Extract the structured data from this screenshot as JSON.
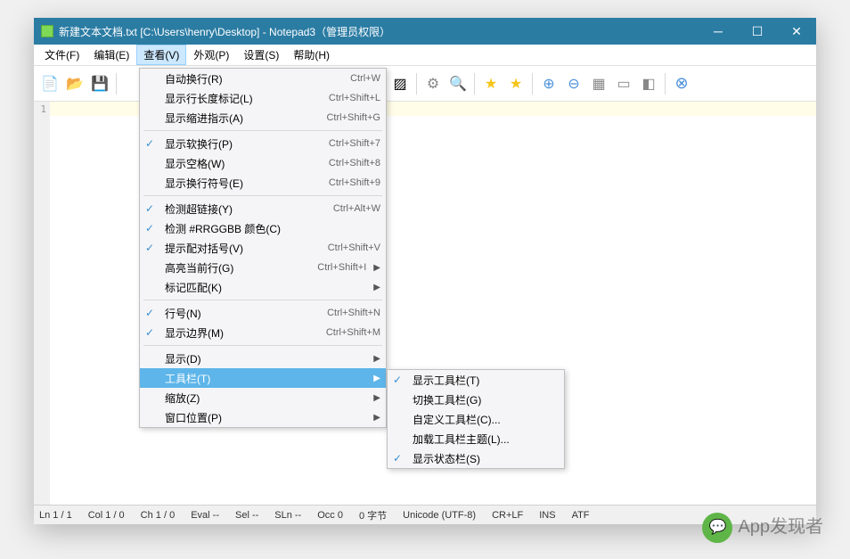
{
  "title": "新建文本文档.txt [C:\\Users\\henry\\Desktop] - Notepad3（管理员权限）",
  "menubar": {
    "file": "文件(F)",
    "edit": "编辑(E)",
    "view": "查看(V)",
    "appearance": "外观(P)",
    "settings": "设置(S)",
    "help": "帮助(H)"
  },
  "gutter_line": "1",
  "view_menu": {
    "word_wrap": "自动换行(R)",
    "word_wrap_acc": "Ctrl+W",
    "long_line_marker": "显示行长度标记(L)",
    "long_line_marker_acc": "Ctrl+Shift+L",
    "indent_guides": "显示缩进指示(A)",
    "indent_guides_acc": "Ctrl+Shift+G",
    "soft_wrap": "显示软换行(P)",
    "soft_wrap_acc": "Ctrl+Shift+7",
    "whitespace": "显示空格(W)",
    "whitespace_acc": "Ctrl+Shift+8",
    "eol": "显示换行符号(E)",
    "eol_acc": "Ctrl+Shift+9",
    "hyperlinks": "检测超链接(Y)",
    "hyperlinks_acc": "Ctrl+Alt+W",
    "rrggbb": "检测 #RRGGBB 颜色(C)",
    "brace_match": "提示配对括号(V)",
    "brace_match_acc": "Ctrl+Shift+V",
    "highlight_line": "高亮当前行(G)",
    "highlight_line_acc": "Ctrl+Shift+I",
    "bookmarks": "标记匹配(K)",
    "line_numbers": "行号(N)",
    "line_numbers_acc": "Ctrl+Shift+N",
    "margin": "显示边界(M)",
    "margin_acc": "Ctrl+Shift+M",
    "display": "显示(D)",
    "toolbars": "工具栏(T)",
    "zoom": "缩放(Z)",
    "window_pos": "窗口位置(P)"
  },
  "toolbars_menu": {
    "show_toolbar": "显示工具栏(T)",
    "switch_toolbar": "切换工具栏(G)",
    "customize_toolbar": "自定义工具栏(C)...",
    "load_theme": "加载工具栏主题(L)...",
    "show_statusbar": "显示状态栏(S)"
  },
  "statusbar": {
    "ln": "Ln  1 / 1",
    "col": "Col  1 / 0",
    "ch": "Ch  1 / 0",
    "eval": "Eval  --",
    "sel": "Sel  --",
    "sln": "SLn  --",
    "occ": "Occ  0",
    "bytes": "0 字节",
    "encoding": "Unicode (UTF-8)",
    "eolm": "CR+LF",
    "ins": "INS",
    "atf": "ATF"
  },
  "watermark": "App发现者"
}
